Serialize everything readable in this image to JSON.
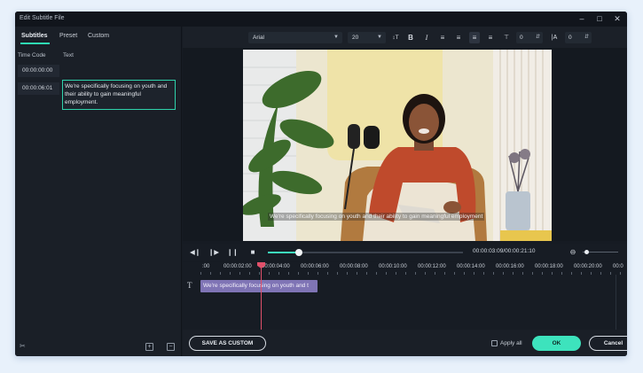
{
  "window": {
    "title": "Edit Subtitle File"
  },
  "tabs": [
    {
      "label": "Subtitles"
    },
    {
      "label": "Preset"
    },
    {
      "label": "Custom"
    }
  ],
  "list": {
    "col_time": "Time Code",
    "col_text": "Text",
    "rows": [
      {
        "time": "00:00:00:00",
        "text": "We're specifically focusing on youth and their ability to gain meaningful employment."
      },
      {
        "time": "00:00:06:01",
        "text": ""
      }
    ]
  },
  "toolbar": {
    "font": "Arial",
    "size": "20",
    "letter_spacing": "0",
    "line_spacing": "0"
  },
  "preview": {
    "subtitle": "We're specifically focusing on youth and their ability to gain meaningful employment"
  },
  "player": {
    "timecode": "00:00:03:09/00:00:21:10",
    "progress": 0.16,
    "zoom": 0.1
  },
  "timeline": {
    "ticks": [
      ":00",
      "00:00:02:00",
      "00:00:04:00",
      "00:00:06:00",
      "00:00:08:00",
      "00:00:10:00",
      "00:00:12:00",
      "00:00:14:00",
      "00:00:16:00",
      "00:00:18:00",
      "00:00:20:00",
      "00:0"
    ],
    "track_icon": "T",
    "clip_text": "We're specifically focusing on youth and t"
  },
  "footer": {
    "save_custom": "SAVE AS CUSTOM",
    "apply_all": "Apply all",
    "ok": "OK",
    "cancel": "Cancel"
  },
  "colors": {
    "accent": "#3de3bd",
    "clip": "#7f74b5",
    "playhead": "#e0506a"
  }
}
